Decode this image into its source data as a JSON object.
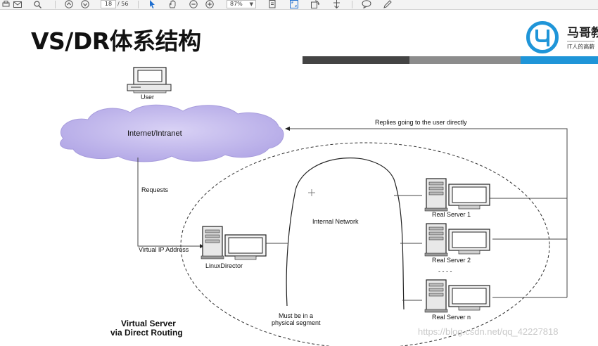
{
  "toolbar": {
    "page_current": "18",
    "page_total": "/ 56",
    "zoom": "87%",
    "icons": [
      "print-icon",
      "mail-icon",
      "search-icon",
      "page-up-icon",
      "page-down-icon",
      "select-arrow-icon",
      "hand-icon",
      "zoom-out-icon",
      "zoom-in-icon",
      "page-view-icon",
      "fit-page-icon",
      "rotate-icon",
      "scroll-icon",
      "comment-icon",
      "pen-icon"
    ]
  },
  "slide": {
    "title": "VS/DR体系结构",
    "logo": {
      "name": "马哥教",
      "tagline": "IT人的高薪"
    },
    "colors": {
      "bar_dark": "#444444",
      "bar_gray": "#8c8c8c",
      "accent_blue": "#1f95d8"
    }
  },
  "diagram": {
    "user_label": "User",
    "cloud_label": "Internet/Intranet",
    "replies_label": "Replies going to the user directly",
    "requests_label": "Requests",
    "vip_label": "Virtual IP Address",
    "director_label": "LinuxDirector",
    "internal_network_label": "Internal Network",
    "real_servers": [
      "Real Server 1",
      "Real Server 2",
      "Real Server n"
    ],
    "ellipsis": "- - - -",
    "segment_note_line1": "Must be in a",
    "segment_note_line2": "physical segment",
    "caption_line1": "Virtual Server",
    "caption_line2": "via Direct Routing"
  },
  "watermark": "https://blog.csdn.net/qq_42227818"
}
